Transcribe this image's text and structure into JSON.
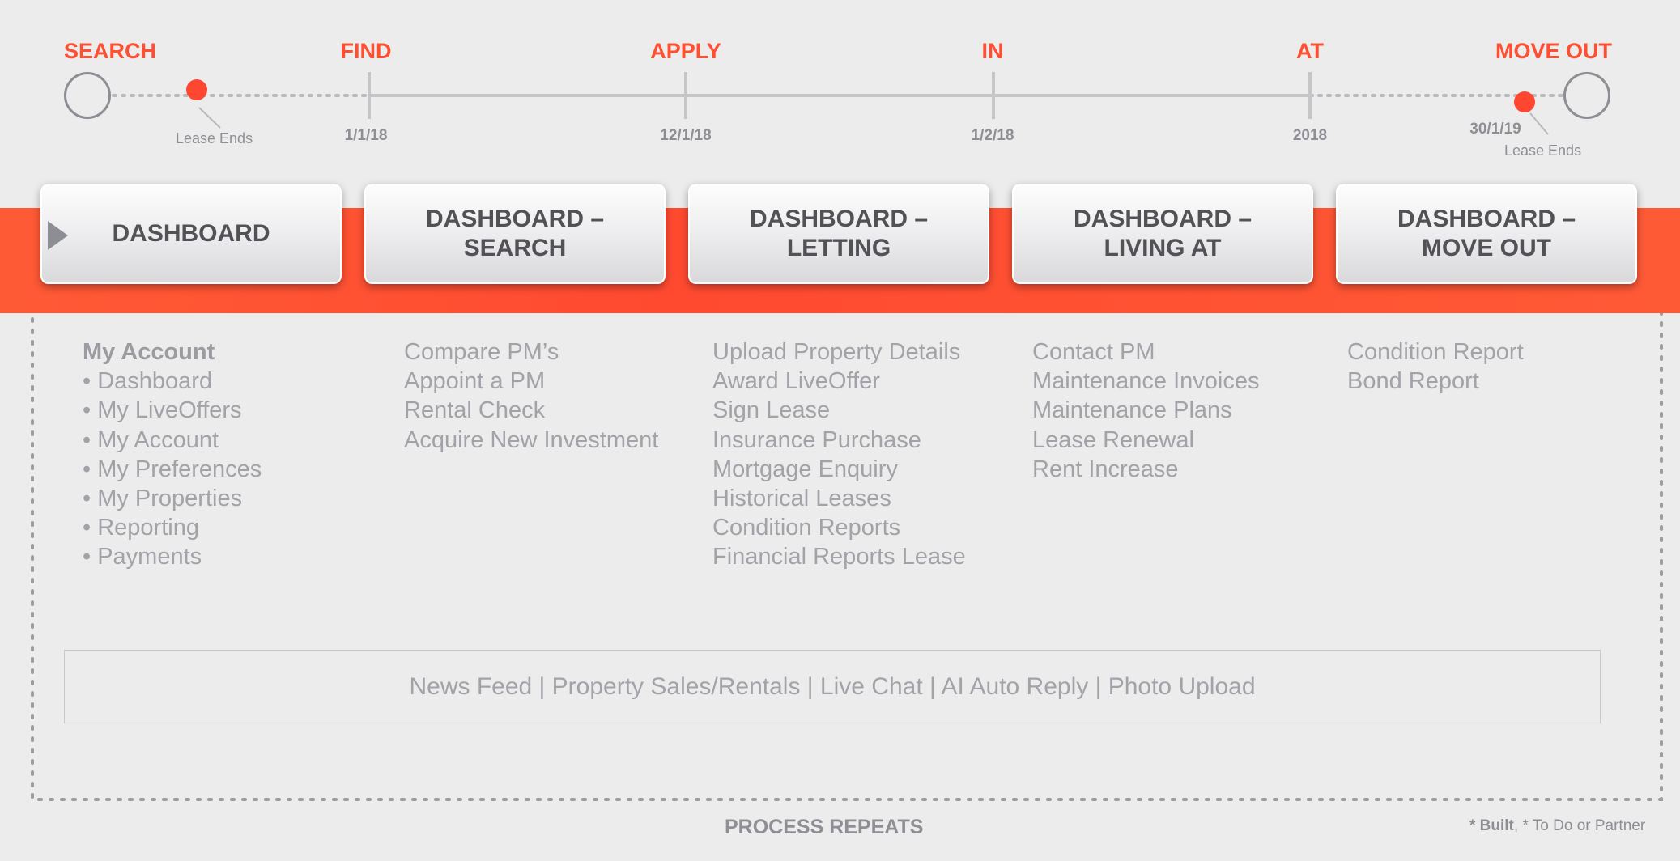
{
  "timeline": {
    "stages": [
      "SEARCH",
      "FIND",
      "APPLY",
      "IN",
      "AT",
      "MOVE OUT"
    ],
    "dates": [
      "1/1/18",
      "12/1/18",
      "1/2/18",
      "2018",
      "30/1/19"
    ],
    "lease_ends_left": "Lease Ends",
    "lease_ends_right": "Lease Ends"
  },
  "cards": [
    "DASHBOARD",
    "DASHBOARD –\nSEARCH",
    "DASHBOARD –\nLETTING",
    "DASHBOARD –\nLIVING AT",
    "DASHBOARD –\nMOVE OUT"
  ],
  "columns": {
    "account": {
      "heading": "My Account",
      "items": [
        "• Dashboard",
        "• My LiveOffers",
        "• My Account",
        "• My Preferences",
        "• My Properties",
        "• Reporting",
        "• Payments"
      ]
    },
    "search": [
      "Compare PM’s",
      "Appoint a PM",
      "Rental Check",
      "Acquire New Investment"
    ],
    "letting": [
      "Upload Property Details",
      "Award LiveOffer",
      "Sign Lease",
      "Insurance Purchase",
      "Mortgage Enquiry",
      "Historical Leases",
      "Condition Reports",
      "Financial Reports Lease"
    ],
    "living": [
      "Contact PM",
      "Maintenance Invoices",
      "Maintenance Plans",
      "Lease Renewal",
      "Rent Increase"
    ],
    "moveout": [
      "Condition Report",
      "Bond Report"
    ]
  },
  "footer_features": "News Feed | Property Sales/Rentals | Live Chat | AI Auto Reply | Photo Upload",
  "process_repeats": "PROCESS REPEATS",
  "legend": {
    "built_star": "* Built",
    "sep": ", ",
    "todo": "* To Do or Partner"
  },
  "colors": {
    "accent": "#ff4f33",
    "grey_text": "#a2a2a8",
    "card_text": "#515156"
  }
}
